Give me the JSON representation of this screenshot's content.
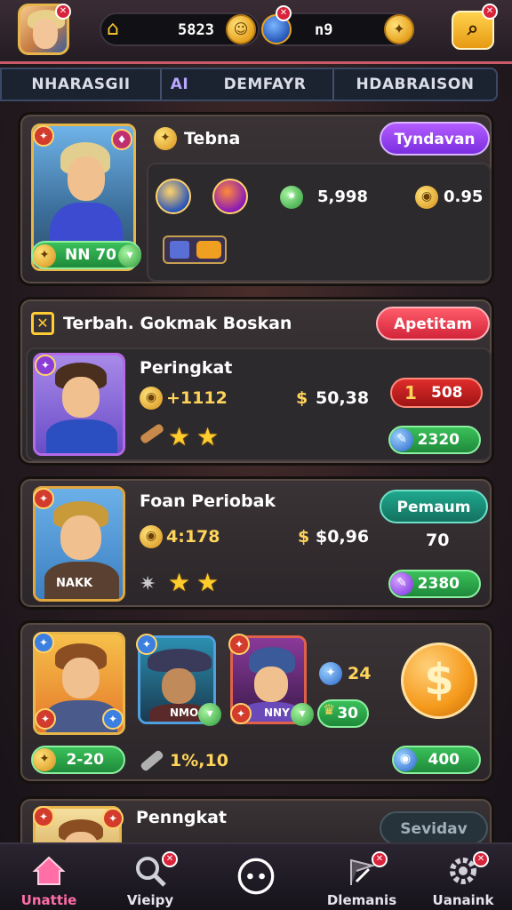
{
  "header": {
    "gold_amount": "5823",
    "gem_amount": "n9"
  },
  "tabs": [
    {
      "label": "NHARASGII"
    },
    {
      "label": "AI"
    },
    {
      "label": "DEMFAYR"
    },
    {
      "label": "HDABRAISON"
    }
  ],
  "card1": {
    "title": "Tebna",
    "action_label": "Tyndavan",
    "level_label": "NN 70",
    "stat_a": "5,998",
    "stat_b": "0.95"
  },
  "card2": {
    "section_title": "Terbah. Gokmak Boskan",
    "action_label": "Apetitam",
    "name": "Peringkat",
    "power": "+1112",
    "ratio": "50,38",
    "red_pill_value": "1",
    "red_pill_text": "508",
    "green_pill": "2320"
  },
  "card3": {
    "name": "Foan Periobak",
    "portrait_label": "NAKK",
    "power": "4:178",
    "ratio": "$0,96",
    "action_label": "Pemaum",
    "side_value": "70",
    "green_pill": "2380"
  },
  "card4": {
    "hero2_label": "NMO",
    "hero3_label": "NNY",
    "count_a": "24",
    "count_b": "30",
    "green_left": "2-20",
    "mid_value": "1%,10",
    "green_right": "400"
  },
  "card5": {
    "name": "Penngkat",
    "action_label": "Sevidav"
  },
  "nav": [
    {
      "label": "Unattie"
    },
    {
      "label": "Vieipy"
    },
    {
      "label": ""
    },
    {
      "label": "Dlemanis"
    },
    {
      "label": "Uanaink"
    }
  ],
  "colors": {
    "accent_pink": "#ff6fa6",
    "gold": "#ffd45a",
    "purple": "#9b45f0",
    "red": "#e0313f",
    "teal": "#1a9a82",
    "green": "#2fb04c"
  }
}
